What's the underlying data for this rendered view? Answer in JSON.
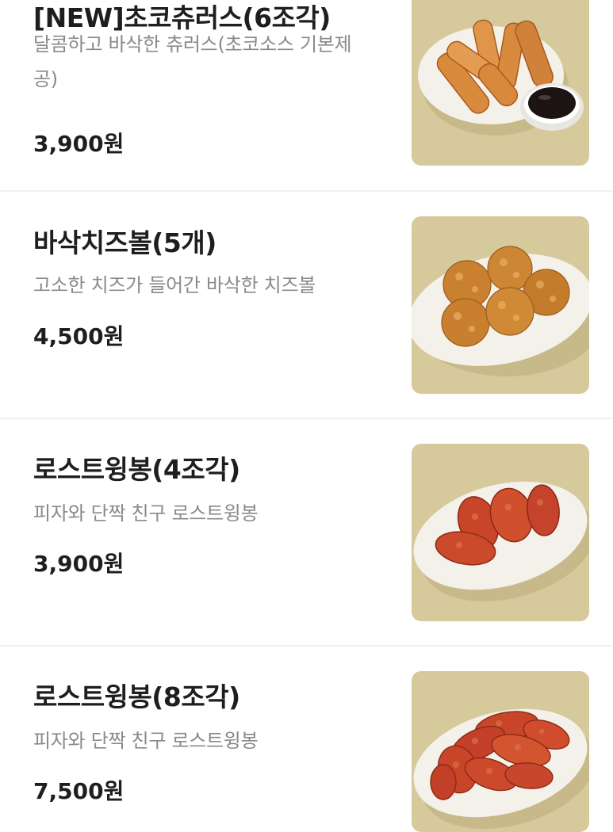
{
  "menu_items": [
    {
      "name": "[NEW]초코츄러스(6조각)",
      "description": "달콤하고 바삭한 츄러스(초코소스 기본제공)",
      "price": "3,900원",
      "image": "churros-with-chocolate-sauce"
    },
    {
      "name": "바삭치즈볼(5개)",
      "description": "고소한 치즈가 들어간 바삭한 치즈볼",
      "price": "4,500원",
      "image": "cheese-balls"
    },
    {
      "name": "로스트윙봉(4조각)",
      "description": "피자와 단짝 친구 로스트윙봉",
      "price": "3,900원",
      "image": "roast-wings-4"
    },
    {
      "name": "로스트윙봉(8조각)",
      "description": "피자와 단짝 친구 로스트윙봉",
      "price": "7,500원",
      "image": "roast-wings-8"
    }
  ],
  "colors": {
    "photo_background": "#d6c99c",
    "plate": "#f4f1ea",
    "churro": "#d98a3c",
    "cheese_ball": "#c9802f",
    "wing": "#c9452a"
  }
}
